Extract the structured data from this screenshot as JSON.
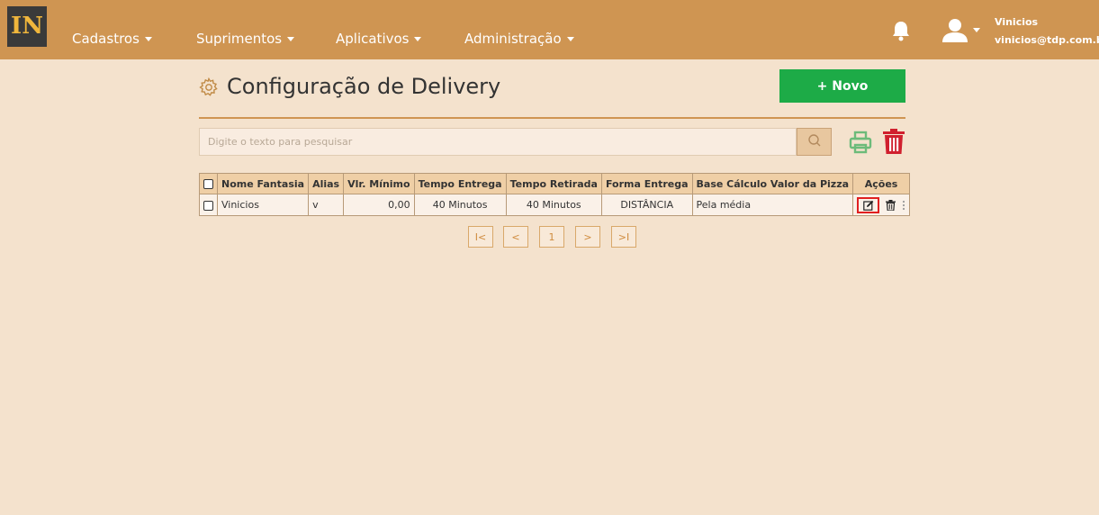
{
  "nav": {
    "logo_text": "IN",
    "menu": [
      {
        "label": "Cadastros"
      },
      {
        "label": "Suprimentos"
      },
      {
        "label": "Aplicativos"
      },
      {
        "label": "Administração"
      }
    ],
    "user": {
      "name": "Vinicios",
      "email": "vinicios@tdp.com.br"
    }
  },
  "header": {
    "title": "Configuração de Delivery",
    "new_button": "+ Novo"
  },
  "search": {
    "placeholder": "Digite o texto para pesquisar"
  },
  "table": {
    "columns": [
      "Nome Fantasia",
      "Alias",
      "Vlr. Mínimo",
      "Tempo Entrega",
      "Tempo Retirada",
      "Forma Entrega",
      "Base Cálculo Valor da Pizza",
      "Ações"
    ],
    "rows": [
      {
        "nome_fantasia": "Vinicios",
        "alias": "v",
        "vlr_minimo": "0,00",
        "tempo_entrega": "40 Minutos",
        "tempo_retirada": "40 Minutos",
        "forma_entrega": "DISTÂNCIA",
        "base_calculo": "Pela média"
      }
    ]
  },
  "pagination": {
    "first": "I<",
    "prev": "<",
    "current": "1",
    "next": ">",
    "last": ">I"
  },
  "colors": {
    "navbar": "#cf9552",
    "background": "#f4e2cd",
    "primary_button": "#1dab47",
    "header_row": "#efcfa6",
    "delete": "#d0202e",
    "print": "#6dbb7a"
  },
  "icons": [
    "logo",
    "bell-icon",
    "user-icon",
    "gear-icon",
    "search-icon",
    "print-icon",
    "trash-icon",
    "edit-icon",
    "more-vertical-icon"
  ]
}
